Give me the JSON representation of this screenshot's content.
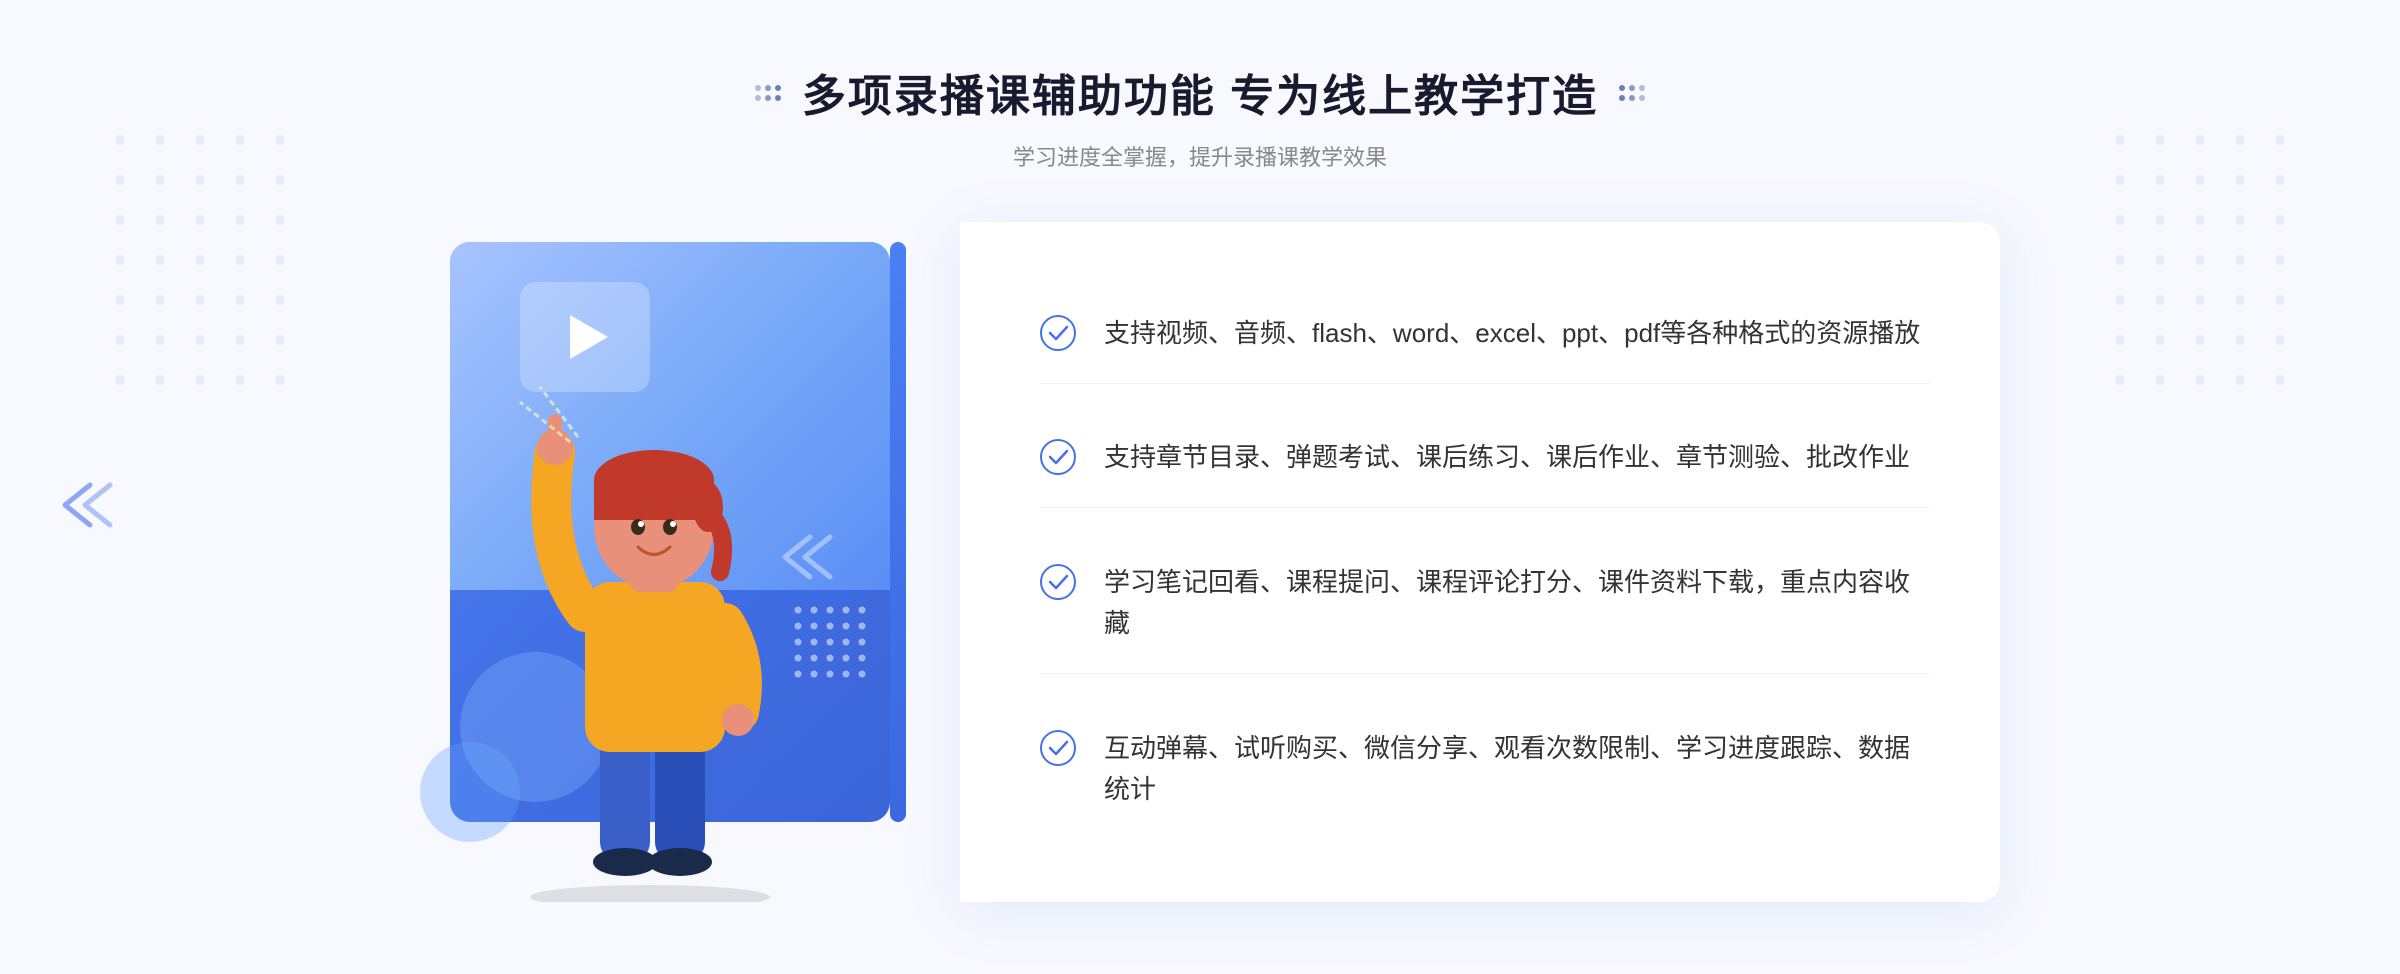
{
  "header": {
    "title": "多项录播课辅助功能 专为线上教学打造",
    "subtitle": "学习进度全掌握，提升录播课教学效果"
  },
  "features": [
    {
      "id": 1,
      "text": "支持视频、音频、flash、word、excel、ppt、pdf等各种格式的资源播放"
    },
    {
      "id": 2,
      "text": "支持章节目录、弹题考试、课后练习、课后作业、章节测验、批改作业"
    },
    {
      "id": 3,
      "text": "学习笔记回看、课程提问、课程评论打分、课件资料下载，重点内容收藏"
    },
    {
      "id": 4,
      "text": "互动弹幕、试听购买、微信分享、观看次数限制、学习进度跟踪、数据统计"
    }
  ],
  "colors": {
    "primary": "#4472e8",
    "primary_light": "#7aaaf8",
    "title": "#1a1a2e",
    "subtitle": "#888888",
    "feature_text": "#333333",
    "check": "#4472e8"
  }
}
